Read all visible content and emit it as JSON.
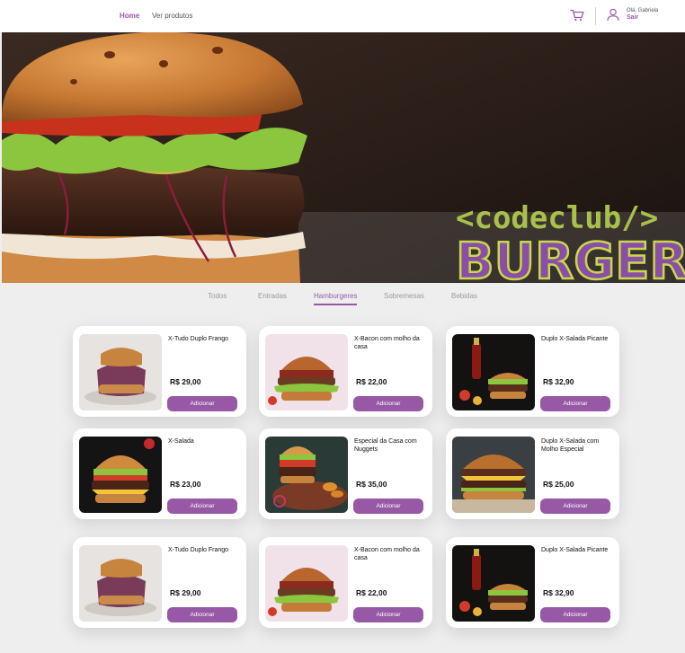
{
  "header": {
    "nav": [
      "Home",
      "Ver produtos"
    ],
    "greeting": "Olá, Gabriela",
    "logout": "Sair",
    "accent_color": "#9758a6"
  },
  "banner": {
    "logo_line1": "<codeclub/>",
    "logo_line2": "BURGER"
  },
  "categories": [
    "Todos",
    "Entradas",
    "Hamburgeres",
    "Sobremesas",
    "Bebidas"
  ],
  "active_category": "Hamburgeres",
  "products": [
    {
      "name": "X-Tudo Duplo Frango",
      "price": "R$ 29,00",
      "button": "Adicionar",
      "image": "chicken-burger"
    },
    {
      "name": "X-Bacon com molho da casa",
      "price": "R$ 22,00",
      "button": "Adicionar",
      "image": "bacon-burger"
    },
    {
      "name": "Duplo X-Salada Picante",
      "price": "R$ 32,90",
      "button": "Adicionar",
      "image": "spicy-burger"
    },
    {
      "name": "X-Salada",
      "price": "R$ 23,00",
      "button": "Adicionar",
      "image": "salad-burger"
    },
    {
      "name": "Especial da Casa com Nuggets",
      "price": "R$ 35,00",
      "button": "Adicionar",
      "image": "special-burger"
    },
    {
      "name": "Duplo X-Salada com Molho Especial",
      "price": "R$ 25,00",
      "button": "Adicionar",
      "image": "double-burger"
    },
    {
      "name": "X-Tudo Duplo Frango",
      "price": "R$ 29,00",
      "button": "Adicionar",
      "image": "chicken-burger"
    },
    {
      "name": "X-Bacon com molho da casa",
      "price": "R$ 22,00",
      "button": "Adicionar",
      "image": "bacon-burger"
    },
    {
      "name": "Duplo X-Salada Picante",
      "price": "R$ 32,90",
      "button": "Adicionar",
      "image": "spicy-burger"
    }
  ]
}
